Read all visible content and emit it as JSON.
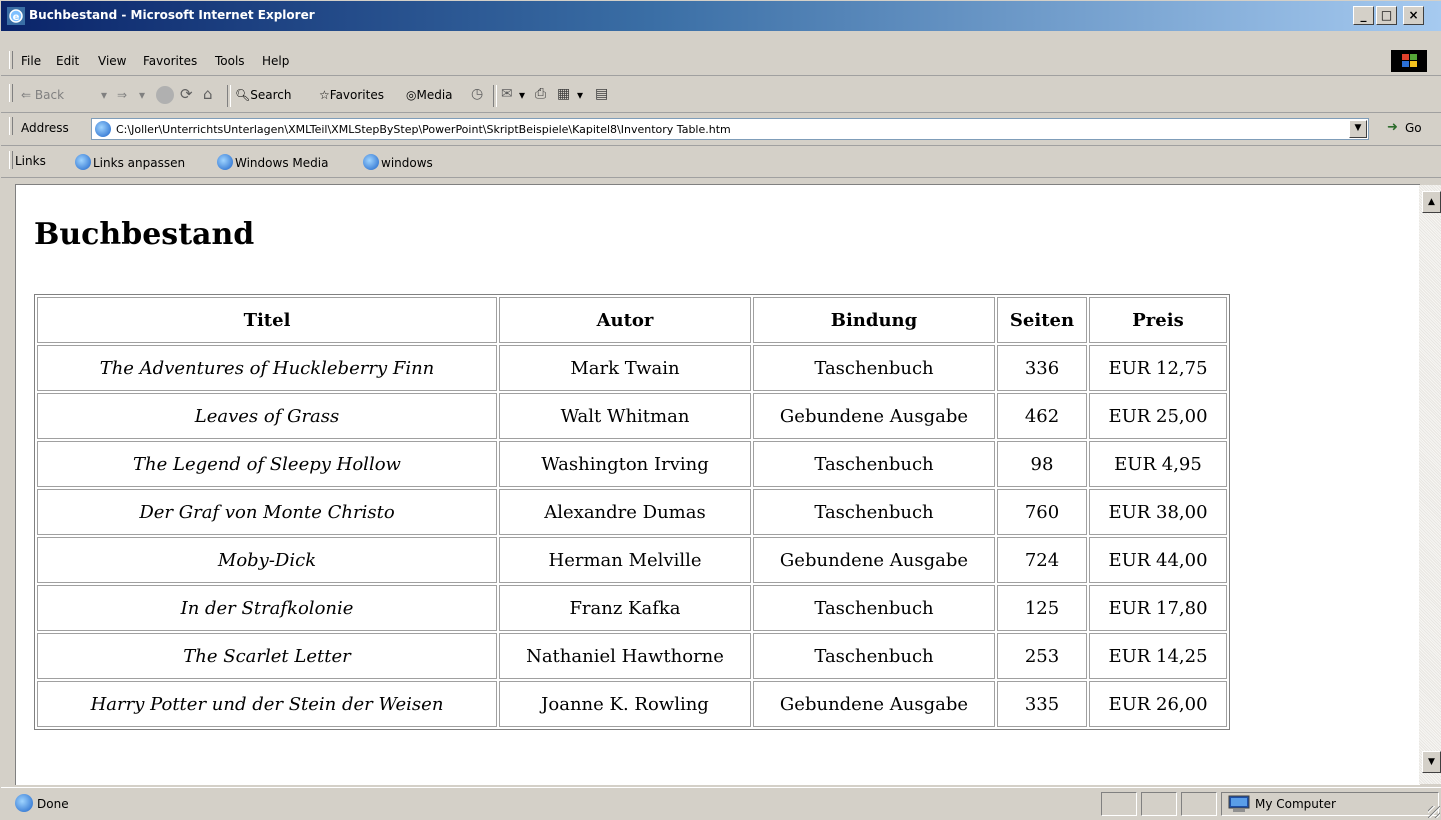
{
  "window": {
    "title": "Buchbestand - Microsoft Internet Explorer",
    "minimize": "_",
    "maximize": "□",
    "close": "×"
  },
  "menu": {
    "items": [
      {
        "label": "File"
      },
      {
        "label": "Edit"
      },
      {
        "label": "View"
      },
      {
        "label": "Favorites"
      },
      {
        "label": "Tools"
      },
      {
        "label": "Help"
      }
    ]
  },
  "toolbar": {
    "back": "Back",
    "search": "Search",
    "favorites": "Favorites",
    "media": "Media",
    "icons": [
      "back-arrow",
      "forward-arrow",
      "stop",
      "refresh",
      "home",
      "search",
      "favorites",
      "media",
      "history",
      "mail",
      "print",
      "edit",
      "discuss"
    ]
  },
  "address": {
    "label": "Address",
    "value": "C:\\Joller\\UnterrichtsUnterlagen\\XMLTeil\\XMLStepByStep\\PowerPoint\\SkriptBeispiele\\Kapitel8\\Inventory Table.htm",
    "go": "Go"
  },
  "links": {
    "label": "Links",
    "items": [
      {
        "label": "Links anpassen"
      },
      {
        "label": "Windows Media"
      },
      {
        "label": "windows"
      }
    ]
  },
  "page": {
    "heading": "Buchbestand",
    "table": {
      "headers": [
        "Titel",
        "Autor",
        "Bindung",
        "Seiten",
        "Preis"
      ],
      "rows": [
        [
          "The Adventures of Huckleberry Finn",
          "Mark Twain",
          "Taschenbuch",
          "336",
          "EUR 12,75"
        ],
        [
          "Leaves of Grass",
          "Walt Whitman",
          "Gebundene Ausgabe",
          "462",
          "EUR 25,00"
        ],
        [
          "The Legend of Sleepy Hollow",
          "Washington Irving",
          "Taschenbuch",
          "98",
          "EUR 4,95"
        ],
        [
          "Der Graf von Monte Christo",
          "Alexandre Dumas",
          "Taschenbuch",
          "760",
          "EUR 38,00"
        ],
        [
          "Moby-Dick",
          "Herman Melville",
          "Gebundene Ausgabe",
          "724",
          "EUR 44,00"
        ],
        [
          "In der Strafkolonie",
          "Franz Kafka",
          "Taschenbuch",
          "125",
          "EUR 17,80"
        ],
        [
          "The Scarlet Letter",
          "Nathaniel Hawthorne",
          "Taschenbuch",
          "253",
          "EUR 14,25"
        ],
        [
          "Harry Potter und der Stein der Weisen",
          "Joanne K. Rowling",
          "Gebundene Ausgabe",
          "335",
          "EUR 26,00"
        ]
      ]
    }
  },
  "status": {
    "text": "Done",
    "zone": "My Computer"
  },
  "colors": {
    "titlebar_start": "#0a246a",
    "titlebar_end": "#a6caf0",
    "chrome": "#d4d0c8",
    "content_bg": "#ffffff"
  }
}
